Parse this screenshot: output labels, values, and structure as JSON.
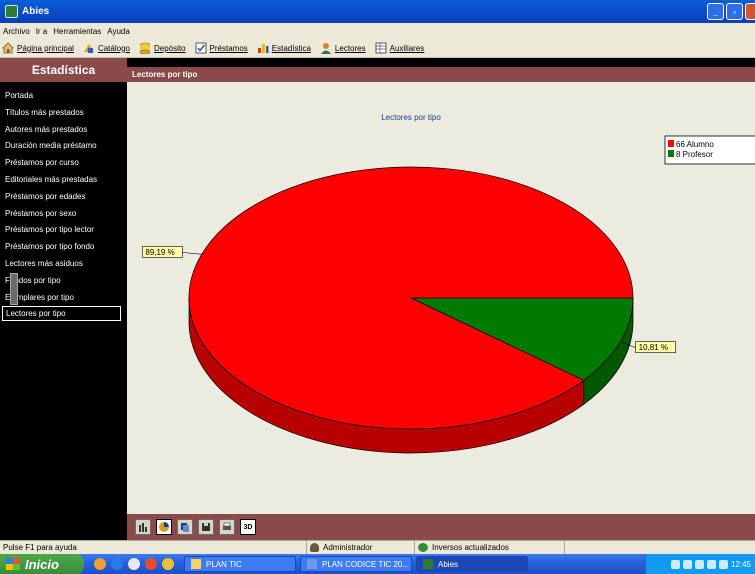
{
  "window": {
    "title": "Abies"
  },
  "menu": [
    "Archivo",
    "Ir a",
    "Herramientas",
    "Ayuda"
  ],
  "toolbar": [
    {
      "label": "Página principal",
      "icon": "home-icon"
    },
    {
      "label": "Catálogo",
      "icon": "catalog-icon"
    },
    {
      "label": "Depósito",
      "icon": "deposit-icon"
    },
    {
      "label": "Préstamos",
      "icon": "loans-icon"
    },
    {
      "label": "Estadística",
      "icon": "statistics-icon"
    },
    {
      "label": "Lectores",
      "icon": "readers-icon"
    },
    {
      "label": "Auxiliares",
      "icon": "auxiliary-icon"
    }
  ],
  "sidebar": {
    "title": "Estadística",
    "items": [
      "Portada",
      "Títulos más prestados",
      "Autores más prestados",
      "Duración media préstamo",
      "Préstamos por curso",
      "Editoriales más prestadas",
      "Préstamos por edades",
      "Préstamos por sexo",
      "Préstamos por tipo lector",
      "Préstamos por tipo fondo",
      "Lectores más asiduos",
      "Fondos por tipo",
      "Ejemplares por tipo",
      "Lectores por tipo"
    ],
    "active_index": 13
  },
  "panel": {
    "title": "Lectores por tipo"
  },
  "chart_data": {
    "type": "pie",
    "title": "Lectores por tipo",
    "slices": [
      {
        "label": "Alumno",
        "value": 66,
        "percent_label": "89,19 %",
        "color": "#ff0000"
      },
      {
        "label": "Profesor",
        "value": 8,
        "percent_label": "10,81 %",
        "color": "#007a00"
      }
    ],
    "legend": [
      "66 Alumno",
      "8 Profesor"
    ],
    "legend_position": "top-right",
    "style": "3d"
  },
  "bottom_toolbar": [
    "bar-chart",
    "pie-chart",
    "copy",
    "save",
    "print",
    "3D"
  ],
  "status": {
    "help": "Pulse F1 para ayuda",
    "user": "Administrador",
    "sync": "Inversos actualizados"
  },
  "taskbar": {
    "start": "Inicio",
    "tasks": [
      "PLAN TIC",
      "PLAN CODICE TIC 20...",
      "Abies"
    ],
    "clock": "12:45"
  }
}
